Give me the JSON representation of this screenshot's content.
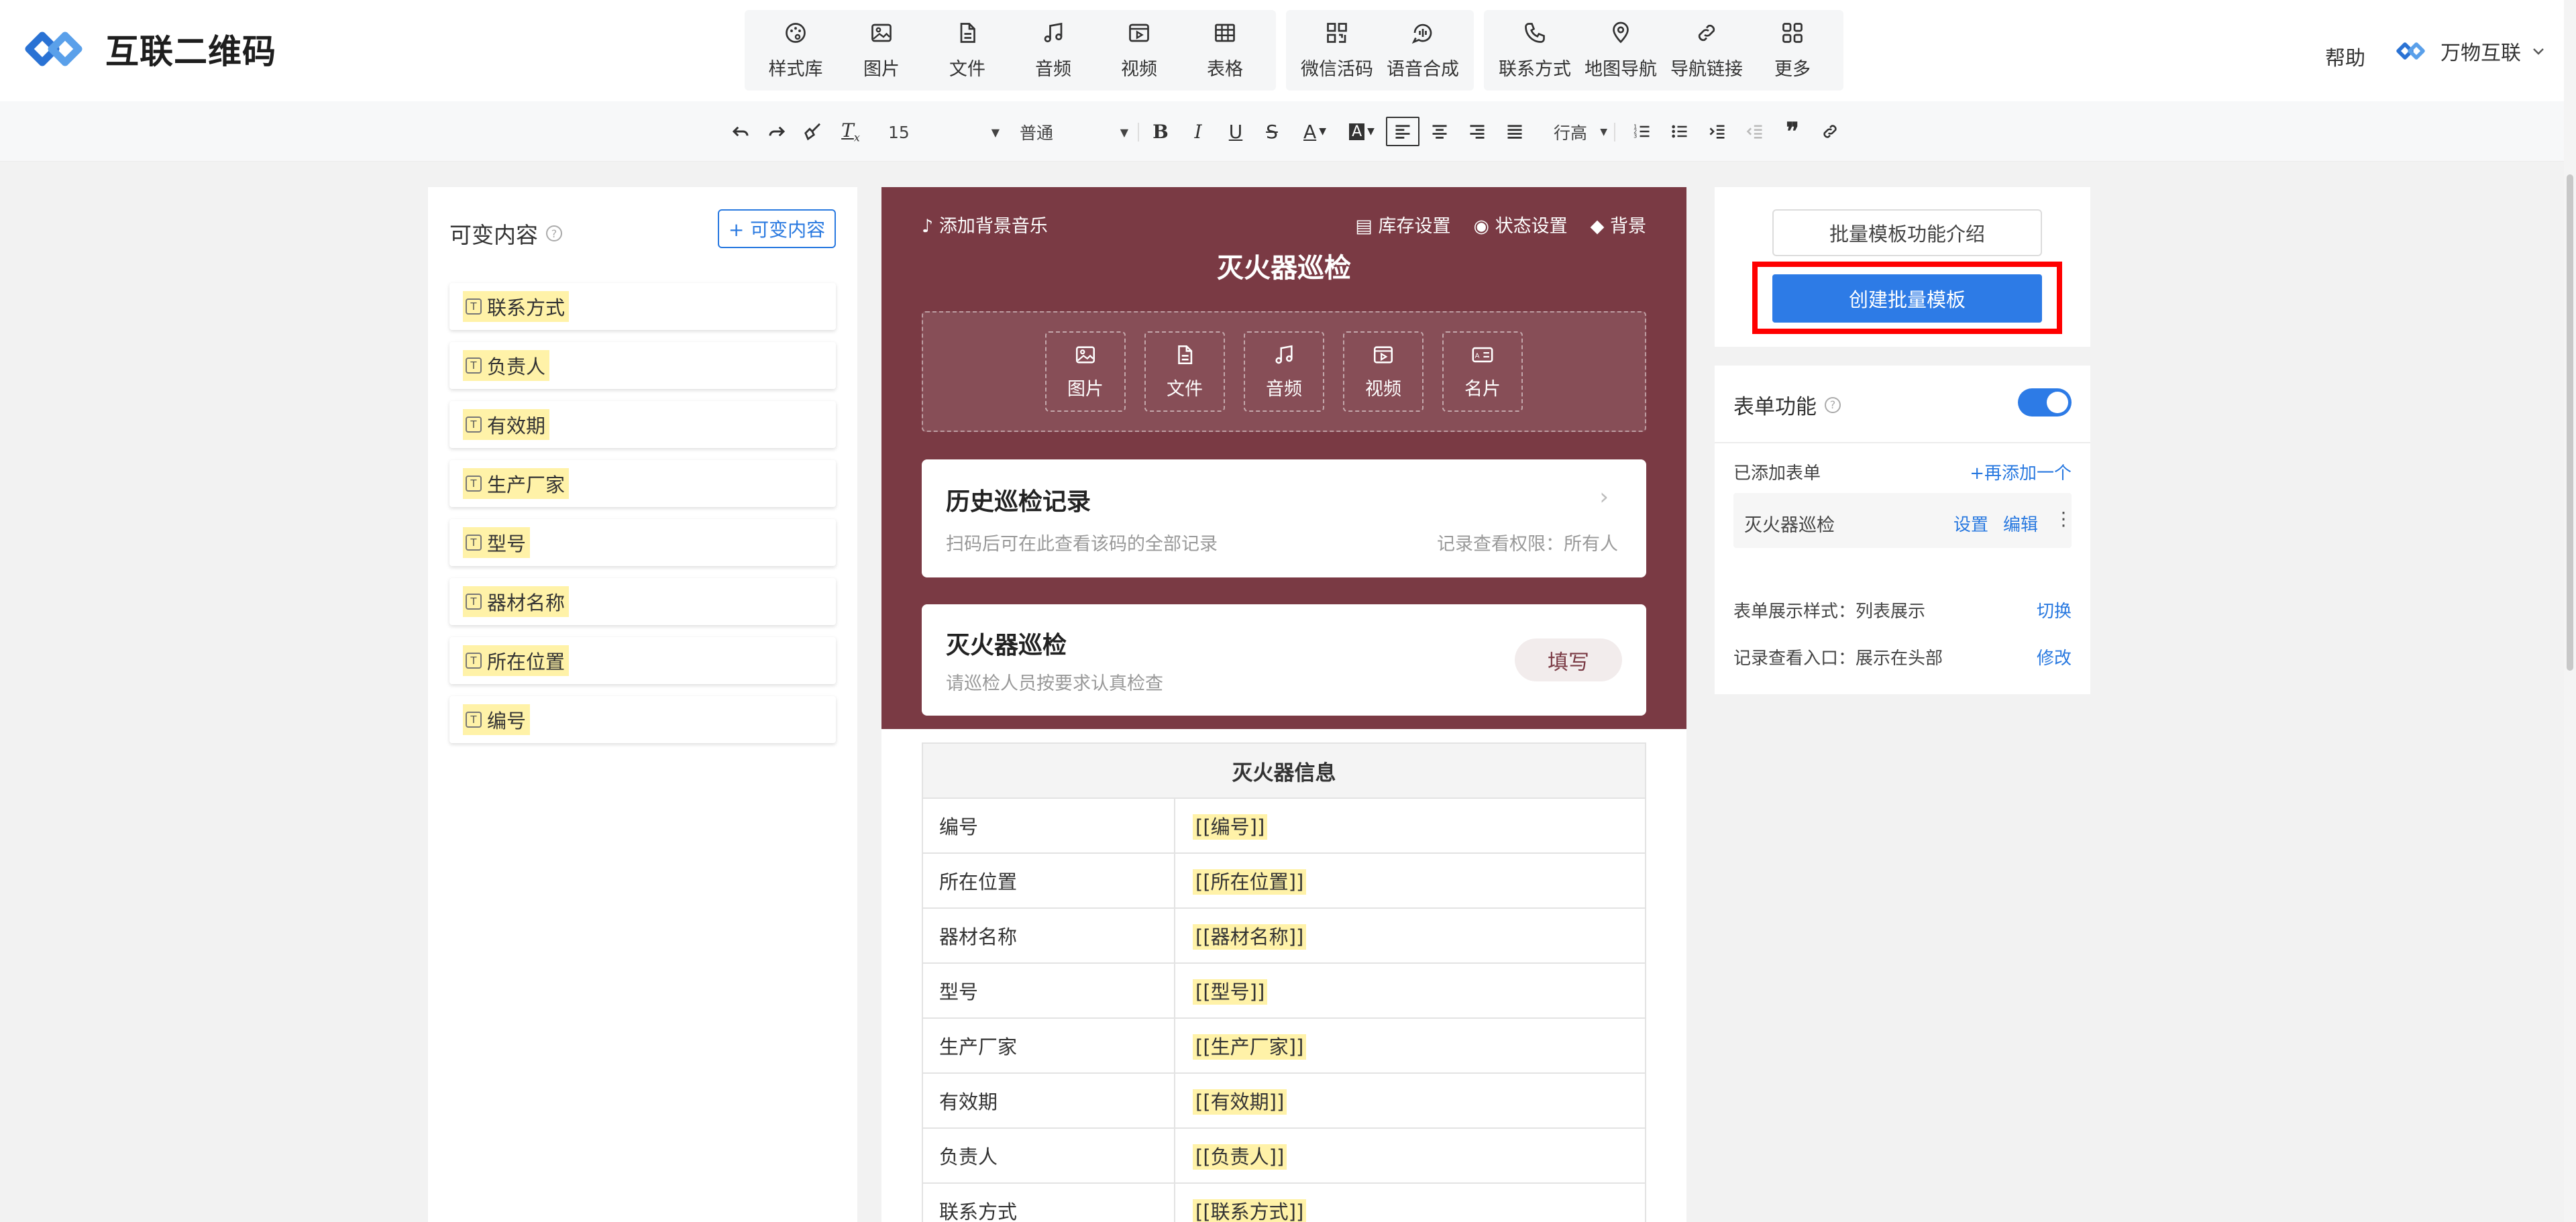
{
  "app": {
    "title": "互联二维码"
  },
  "toolbar": {
    "groups": [
      [
        {
          "label": "样式库",
          "icon": "palette-icon"
        },
        {
          "label": "图片",
          "icon": "image-icon"
        },
        {
          "label": "文件",
          "icon": "file-icon"
        },
        {
          "label": "音频",
          "icon": "music-icon"
        },
        {
          "label": "视频",
          "icon": "video-icon"
        },
        {
          "label": "表格",
          "icon": "table-icon"
        }
      ],
      [
        {
          "label": "微信活码",
          "icon": "qrcode-icon"
        },
        {
          "label": "语音合成",
          "icon": "voice-icon"
        }
      ],
      [
        {
          "label": "联系方式",
          "icon": "phone-icon"
        },
        {
          "label": "地图导航",
          "icon": "map-pin-icon"
        },
        {
          "label": "导航链接",
          "icon": "link-icon"
        },
        {
          "label": "更多",
          "icon": "grid-icon"
        }
      ]
    ],
    "help": "帮助",
    "brand": "万物互联"
  },
  "format_bar": {
    "font_size": "15",
    "paragraph": "普通",
    "line_height": "行高"
  },
  "variables": {
    "title": "可变内容",
    "add_button": "+ 可变内容",
    "items": [
      "联系方式",
      "负责人",
      "有效期",
      "生产厂家",
      "型号",
      "器材名称",
      "所在位置",
      "编号"
    ]
  },
  "preview": {
    "add_music": "添加背景音乐",
    "header_actions": [
      "库存设置",
      "状态设置",
      "背景"
    ],
    "title": "灭火器巡检",
    "media_items": [
      "图片",
      "文件",
      "音频",
      "视频",
      "名片"
    ],
    "history_card": {
      "title": "历史巡检记录",
      "subtitle": "扫码后可在此查看该码的全部记录",
      "permission": "记录查看权限：所有人"
    },
    "form_card": {
      "title": "灭火器巡检",
      "subtitle": "请巡检人员按要求认真检查",
      "button": "填写"
    },
    "table": {
      "header": "灭火器信息",
      "rows": [
        {
          "key": "编号",
          "value": "[[编号]]"
        },
        {
          "key": "所在位置",
          "value": "[[所在位置]]"
        },
        {
          "key": "器材名称",
          "value": "[[器材名称]]"
        },
        {
          "key": "型号",
          "value": "[[型号]]"
        },
        {
          "key": "生产厂家",
          "value": "[[生产厂家]]"
        },
        {
          "key": "有效期",
          "value": "[[有效期]]"
        },
        {
          "key": "负责人",
          "value": "[[负责人]]"
        },
        {
          "key": "联系方式",
          "value": "[[联系方式]]"
        }
      ]
    }
  },
  "right_panel": {
    "intro_button": "批量模板功能介绍",
    "create_button": "创建批量模板",
    "form_feature": "表单功能",
    "form_enabled": true,
    "added_forms": "已添加表单",
    "add_another": "+再添加一个",
    "form_name": "灭火器巡检",
    "form_settings": "设置",
    "form_edit": "编辑",
    "display_style_label": "表单展示样式：",
    "display_style_value": "列表展示",
    "switch": "切换",
    "record_entry_label": "记录查看入口：",
    "record_entry_value": "展示在头部",
    "modify": "修改"
  },
  "colors": {
    "accent": "#2d7be6",
    "header_bg": "#7a3a44",
    "highlight": "#fff2a8",
    "annotation": "#ff0000"
  }
}
